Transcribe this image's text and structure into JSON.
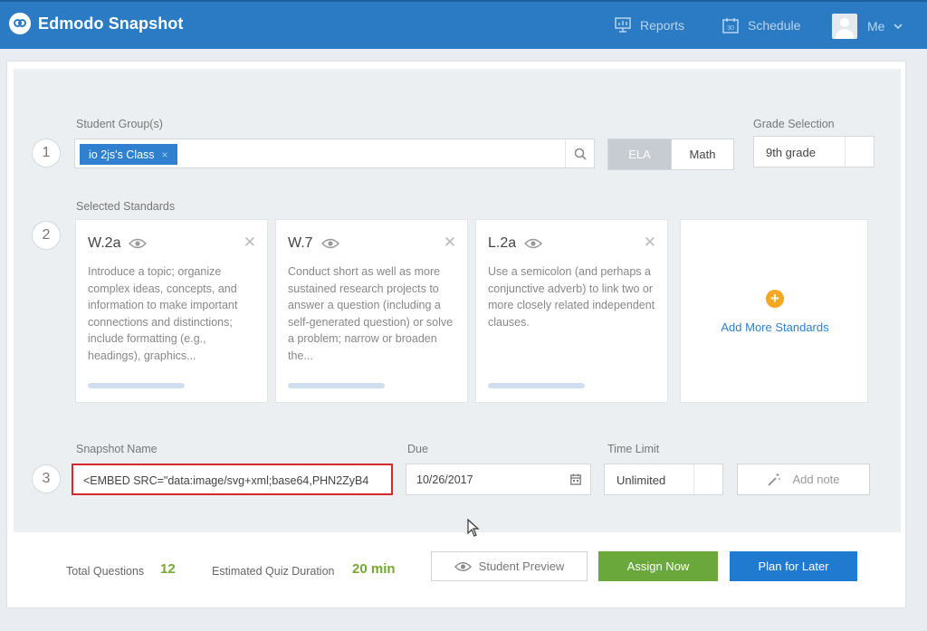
{
  "header": {
    "app_name": "Edmodo Snapshot",
    "nav": [
      {
        "label": "Reports",
        "icon": "reports-icon"
      },
      {
        "label": "Schedule",
        "icon": "calendar-icon"
      }
    ],
    "user_label": "Me"
  },
  "steps": [
    "1",
    "2",
    "3"
  ],
  "student_groups": {
    "label": "Student Group(s)",
    "tag": "io 2js's Class",
    "tag_remove": "×"
  },
  "subjects": {
    "ela": "ELA",
    "math": "Math",
    "selected": "ELA"
  },
  "grade": {
    "label": "Grade Selection",
    "value": "9th grade"
  },
  "standards": {
    "label": "Selected Standards",
    "cards": [
      {
        "code": "W.2a",
        "text": "Introduce a topic; organize complex ideas, concepts, and information to make important connections and distinctions; include formatting (e.g., headings), graphics..."
      },
      {
        "code": "W.7",
        "text": "Conduct short as well as more sustained research projects to answer a question (including a self-generated question) or solve a problem; narrow or broaden the..."
      },
      {
        "code": "L.2a",
        "text": "Use a semicolon (and perhaps a conjunctive adverb) to link two or more closely related independent clauses."
      }
    ],
    "add_more": "Add More Standards"
  },
  "snapshot": {
    "name_label": "Snapshot Name",
    "name_value": "<EMBED SRC=\"data:image/svg+xml;base64,PHN2ZyB4",
    "due_label": "Due",
    "due_value": "10/26/2017",
    "time_label": "Time Limit",
    "time_value": "Unlimited",
    "add_note": "Add note"
  },
  "footer": {
    "total_label": "Total Questions",
    "total_value": "12",
    "duration_label": "Estimated Quiz Duration",
    "duration_value": "20 min",
    "preview": "Student Preview",
    "assign": "Assign Now",
    "plan": "Plan for Later"
  },
  "colors": {
    "header": "#2b7bc4",
    "accent": "#2f80cf",
    "assign": "#6aa83b",
    "plan": "#1f7ad0",
    "highlight": "#d9262c",
    "add_icon": "#f5a623"
  }
}
